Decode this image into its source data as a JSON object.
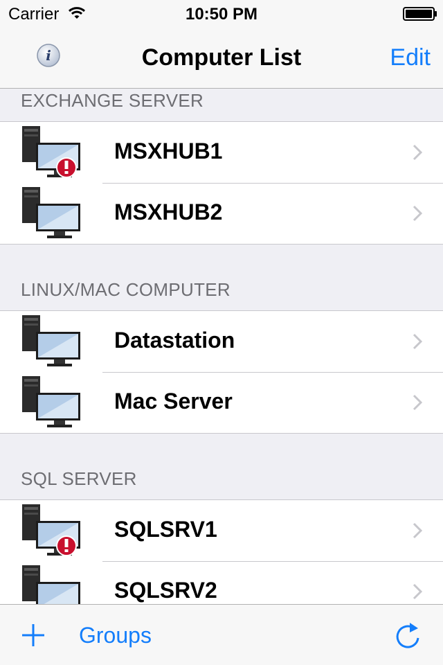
{
  "status_bar": {
    "carrier": "Carrier",
    "time": "10:50 PM"
  },
  "nav": {
    "title": "Computer List",
    "edit_label": "Edit",
    "info_icon": "info-icon"
  },
  "sections": [
    {
      "header": "EXCHANGE SERVER",
      "items": [
        {
          "name": "MSXHUB1",
          "alert": true
        },
        {
          "name": "MSXHUB2",
          "alert": false
        }
      ]
    },
    {
      "header": "LINUX/MAC COMPUTER",
      "items": [
        {
          "name": "Datastation",
          "alert": false
        },
        {
          "name": "Mac Server",
          "alert": false
        }
      ]
    },
    {
      "header": "SQL SERVER",
      "items": [
        {
          "name": "SQLSRV1",
          "alert": true
        },
        {
          "name": "SQLSRV2",
          "alert": false
        }
      ]
    }
  ],
  "toolbar": {
    "groups_label": "Groups",
    "add_icon": "plus-icon",
    "refresh_icon": "refresh-icon"
  },
  "colors": {
    "accent": "#147efb",
    "alert": "#c8102e",
    "background": "#efeff4"
  }
}
